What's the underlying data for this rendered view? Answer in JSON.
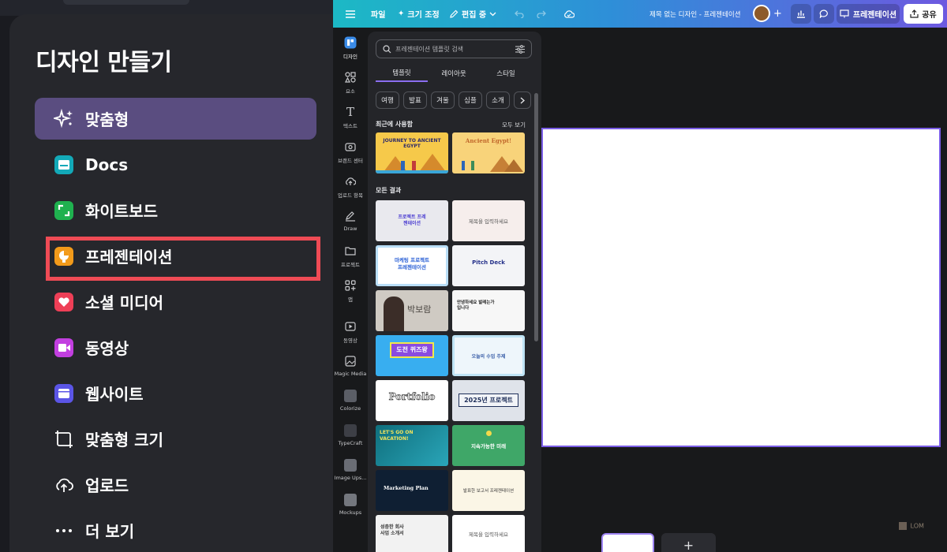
{
  "create_panel": {
    "title": "디자인 만들기",
    "items": [
      {
        "label": "맞춤형",
        "icon": "sparkle-icon",
        "active": true
      },
      {
        "label": "Docs",
        "icon": "docs-icon",
        "color": "#13a9b8"
      },
      {
        "label": "화이트보드",
        "icon": "whiteboard-icon",
        "color": "#1fb14f"
      },
      {
        "label": "프레젠테이션",
        "icon": "presentation-icon",
        "color": "#f29a1a"
      },
      {
        "label": "소셜 미디어",
        "icon": "heart-icon",
        "color": "#ee3f57"
      },
      {
        "label": "동영상",
        "icon": "video-icon",
        "color": "#c23fe0"
      },
      {
        "label": "웹사이트",
        "icon": "website-icon",
        "color": "#5b55e6"
      },
      {
        "label": "맞춤형 크기",
        "icon": "resize-icon"
      },
      {
        "label": "업로드",
        "icon": "cloud-upload-icon"
      },
      {
        "label": "더 보기",
        "icon": "more-icon"
      }
    ],
    "highlight_color": "#ef4b55"
  },
  "editor": {
    "topbar": {
      "file": "파일",
      "resize": "크기 조정",
      "edit_mode": "편집 중",
      "doc_title": "제목 없는 디자인 - 프레젠테이션",
      "present": "프레젠테이션",
      "share": "공유"
    },
    "rail": [
      {
        "label": "디자인",
        "icon": "design-icon",
        "active": true
      },
      {
        "label": "요소",
        "icon": "elements-icon"
      },
      {
        "label": "텍스트",
        "icon": "text-icon"
      },
      {
        "label": "브랜드 센터",
        "icon": "brand-icon"
      },
      {
        "label": "업로드 항목",
        "icon": "upload-icon"
      },
      {
        "label": "Draw",
        "icon": "draw-icon"
      },
      {
        "label": "프로젝트",
        "icon": "folder-icon"
      },
      {
        "label": "앱",
        "icon": "apps-icon"
      },
      {
        "label": "동영상",
        "icon": "video-icon"
      },
      {
        "label": "Magic Media",
        "icon": "magic-media-icon"
      },
      {
        "label": "Colorize",
        "icon": "colorize-icon"
      },
      {
        "label": "TypeCraft",
        "icon": "typecraft-icon"
      },
      {
        "label": "Image Ups...",
        "icon": "image-upscaler-icon"
      },
      {
        "label": "Mockups",
        "icon": "mockups-icon"
      }
    ],
    "templates_panel": {
      "search_placeholder": "프레젠테이션 템플릿 검색",
      "tabs": [
        "템플릿",
        "레이아웃",
        "스타일"
      ],
      "chips": [
        "여행",
        "발표",
        "겨울",
        "심플",
        "소개"
      ],
      "recent_label": "최근에 사용함",
      "see_all": "모두 보기",
      "all_results_label": "모든 결과",
      "recent_templates": [
        {
          "title": "JOURNEY TO ANCIENT EGYPT"
        },
        {
          "title": "Ancient Egypt!"
        }
      ],
      "results": [
        {
          "title": "프로젝트 프레젠테이션"
        },
        {
          "title": "제목을 입력하세요"
        },
        {
          "title": "마케팅 프로젝트 프레젠테이션"
        },
        {
          "title": "Pitch Deck"
        },
        {
          "title": "박보람"
        },
        {
          "title": "안녕하세요 발레는가입니다"
        },
        {
          "title": "도전 퀴즈왕"
        },
        {
          "title": "오늘의 수업 주제"
        },
        {
          "title": "Portfolio"
        },
        {
          "title": "2025년 프로젝트"
        },
        {
          "title": "LET'S GO ON VACATION!"
        },
        {
          "title": "지속가능한 미래"
        },
        {
          "title": "Marketing Plan"
        },
        {
          "title": "발표한 보고서 프레젠테이션"
        },
        {
          "title": "성층한 회사 사업 소개서"
        },
        {
          "title": "제목을 입력하세요"
        }
      ]
    },
    "add_page": "+",
    "watermark": "LOM"
  }
}
